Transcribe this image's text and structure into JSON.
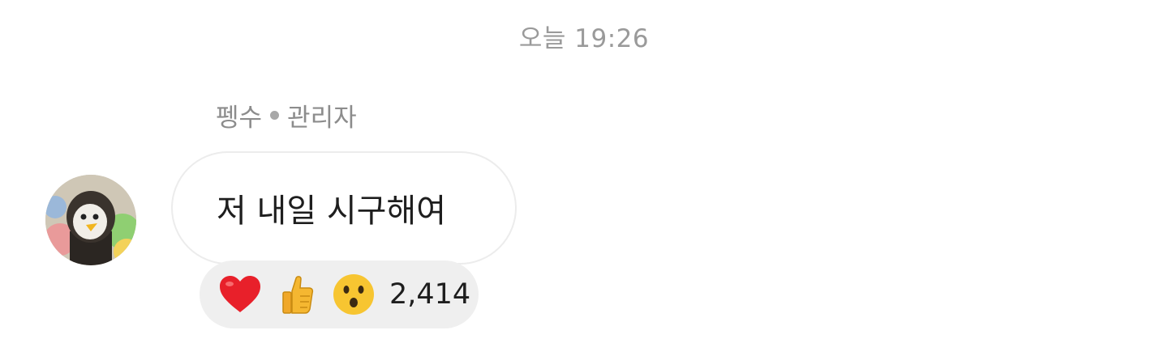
{
  "timestamp": "오늘 19:26",
  "sender": {
    "name": "펭수",
    "role": "관리자"
  },
  "message": {
    "text": "저 내일 시구해여"
  },
  "reactions": {
    "icons": [
      "heart-icon",
      "thumbs-up-icon",
      "surprised-face-icon"
    ],
    "count": "2,414"
  },
  "colors": {
    "bubble_border": "#ececec",
    "reaction_bg": "#efefef",
    "meta_text": "#9a9a9a",
    "heart": "#e8202a",
    "thumb": "#f5b731"
  }
}
